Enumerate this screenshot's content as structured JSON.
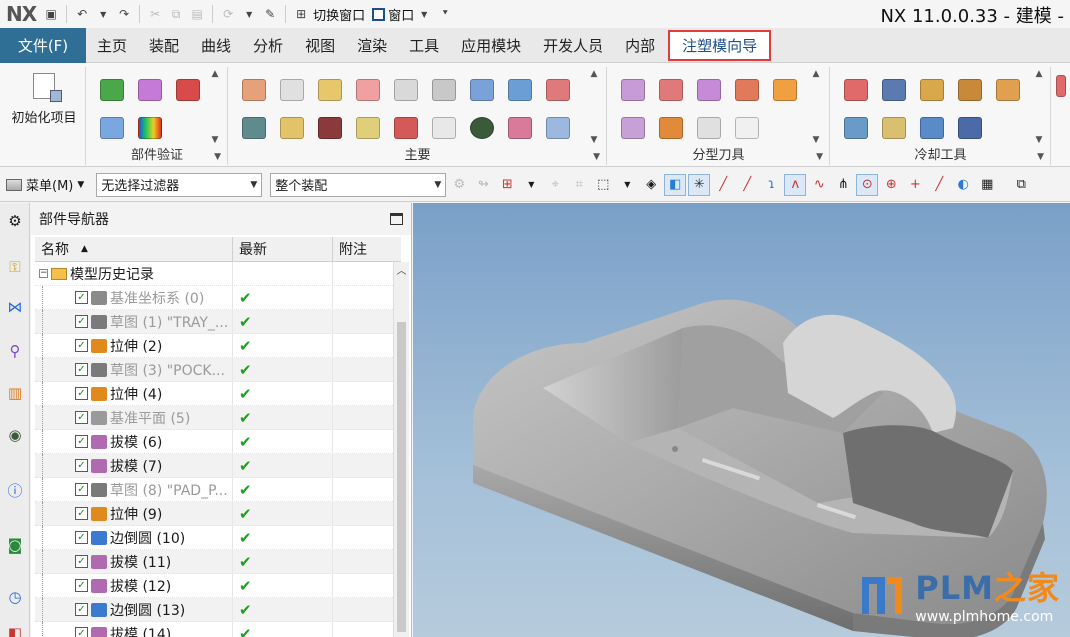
{
  "app": {
    "logo": "NX",
    "title": "NX 11.0.0.33 - 建模 -"
  },
  "quick_access": {
    "switch_window": "切换窗口",
    "window": "窗口"
  },
  "tabs": [
    "主页",
    "装配",
    "曲线",
    "分析",
    "视图",
    "渲染",
    "工具",
    "应用模块",
    "开发人员",
    "内部"
  ],
  "file_tab": "文件(F)",
  "active_tab": "注塑模向导",
  "ribbon": {
    "init_project": "初始化项目",
    "groups": [
      {
        "label": "部件验证"
      },
      {
        "label": "主要"
      },
      {
        "label": "分型刀具"
      },
      {
        "label": "冷却工具"
      }
    ]
  },
  "selection_bar": {
    "menu": "菜单(M)",
    "filter": "无选择过滤器",
    "scope": "整个装配"
  },
  "navigator": {
    "title": "部件导航器",
    "columns": [
      "名称",
      "最新",
      "附注"
    ],
    "root": "模型历史记录",
    "items": [
      {
        "name": "基准坐标系 (0)",
        "grey": true,
        "icon": "datum-csys-icon",
        "color": "#8a8a8a"
      },
      {
        "name": "草图 (1) \"TRAY_...",
        "grey": true,
        "icon": "sketch-icon",
        "color": "#7a7a7a"
      },
      {
        "name": "拉伸 (2)",
        "grey": false,
        "icon": "extrude-icon",
        "color": "#e08a1e"
      },
      {
        "name": "草图 (3) \"POCK...",
        "grey": true,
        "icon": "sketch-icon",
        "color": "#7a7a7a"
      },
      {
        "name": "拉伸 (4)",
        "grey": false,
        "icon": "extrude-icon",
        "color": "#e08a1e"
      },
      {
        "name": "基准平面 (5)",
        "grey": true,
        "icon": "datum-plane-icon",
        "color": "#9a9a9a"
      },
      {
        "name": "拔模 (6)",
        "grey": false,
        "icon": "draft-icon",
        "color": "#b06ab0"
      },
      {
        "name": "拔模 (7)",
        "grey": false,
        "icon": "draft-icon",
        "color": "#b06ab0"
      },
      {
        "name": "草图 (8) \"PAD_P...",
        "grey": true,
        "icon": "sketch-icon",
        "color": "#7a7a7a"
      },
      {
        "name": "拉伸 (9)",
        "grey": false,
        "icon": "extrude-icon",
        "color": "#e08a1e"
      },
      {
        "name": "边倒圆 (10)",
        "grey": false,
        "icon": "edge-blend-icon",
        "color": "#3a7ad0"
      },
      {
        "name": "拔模 (11)",
        "grey": false,
        "icon": "draft-icon",
        "color": "#b06ab0"
      },
      {
        "name": "拔模 (12)",
        "grey": false,
        "icon": "draft-icon",
        "color": "#b06ab0"
      },
      {
        "name": "边倒圆 (13)",
        "grey": false,
        "icon": "edge-blend-icon",
        "color": "#3a7ad0"
      },
      {
        "name": "拔模 (14)",
        "grey": false,
        "icon": "draft-icon",
        "color": "#b06ab0"
      }
    ]
  },
  "watermark": {
    "brand_a": "PLM",
    "brand_b": "之家",
    "url": "www.plmhome.com"
  },
  "colors": {
    "file_tab": "#2f6f96",
    "active_tab_border": "#e03c3c",
    "viewport_top": "#7aa0c8",
    "viewport_bottom": "#b6cbdc",
    "model": "#9c9c9c"
  }
}
